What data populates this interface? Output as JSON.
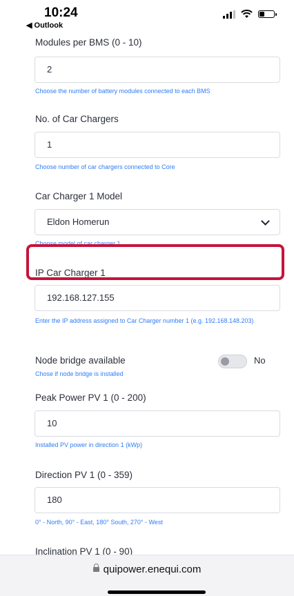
{
  "status_bar": {
    "time": "10:24",
    "back_app": "◀ Outlook"
  },
  "form": {
    "modules_per_bms": {
      "label": "Modules per BMS (0 - 10)",
      "value": "2",
      "hint": "Choose the number of battery modules connected to each BMS"
    },
    "car_chargers": {
      "label": "No. of Car Chargers",
      "value": "1",
      "hint": "Choose number of car chargers connected to Core"
    },
    "charger_model": {
      "label": "Car Charger 1 Model",
      "value": "Eldon Homerun",
      "hint": "Choose model of car charger 1"
    },
    "ip_charger": {
      "label": "IP Car Charger 1",
      "value": "192.168.127.155",
      "hint": "Enter the IP address assigned to Car Charger number 1 (e.g. 192.168.148.203)"
    },
    "node_bridge": {
      "label": "Node bridge available",
      "state": "No",
      "hint": "Chose if node bridge is installed"
    },
    "peak_power_pv1": {
      "label": "Peak Power PV 1 (0 - 200)",
      "value": "10",
      "hint": "Installed PV power in direction 1 (kWp)"
    },
    "direction_pv1": {
      "label": "Direction PV 1 (0 - 359)",
      "value": "180",
      "hint": "0° - North, 90° - East, 180° South, 270° - West"
    },
    "inclination_pv1": {
      "label": "Inclination PV 1 (0 - 90)"
    }
  },
  "browser": {
    "url": "quipower.enequi.com"
  },
  "colors": {
    "hint": "#2f7cf6",
    "highlight": "#c7133a"
  }
}
